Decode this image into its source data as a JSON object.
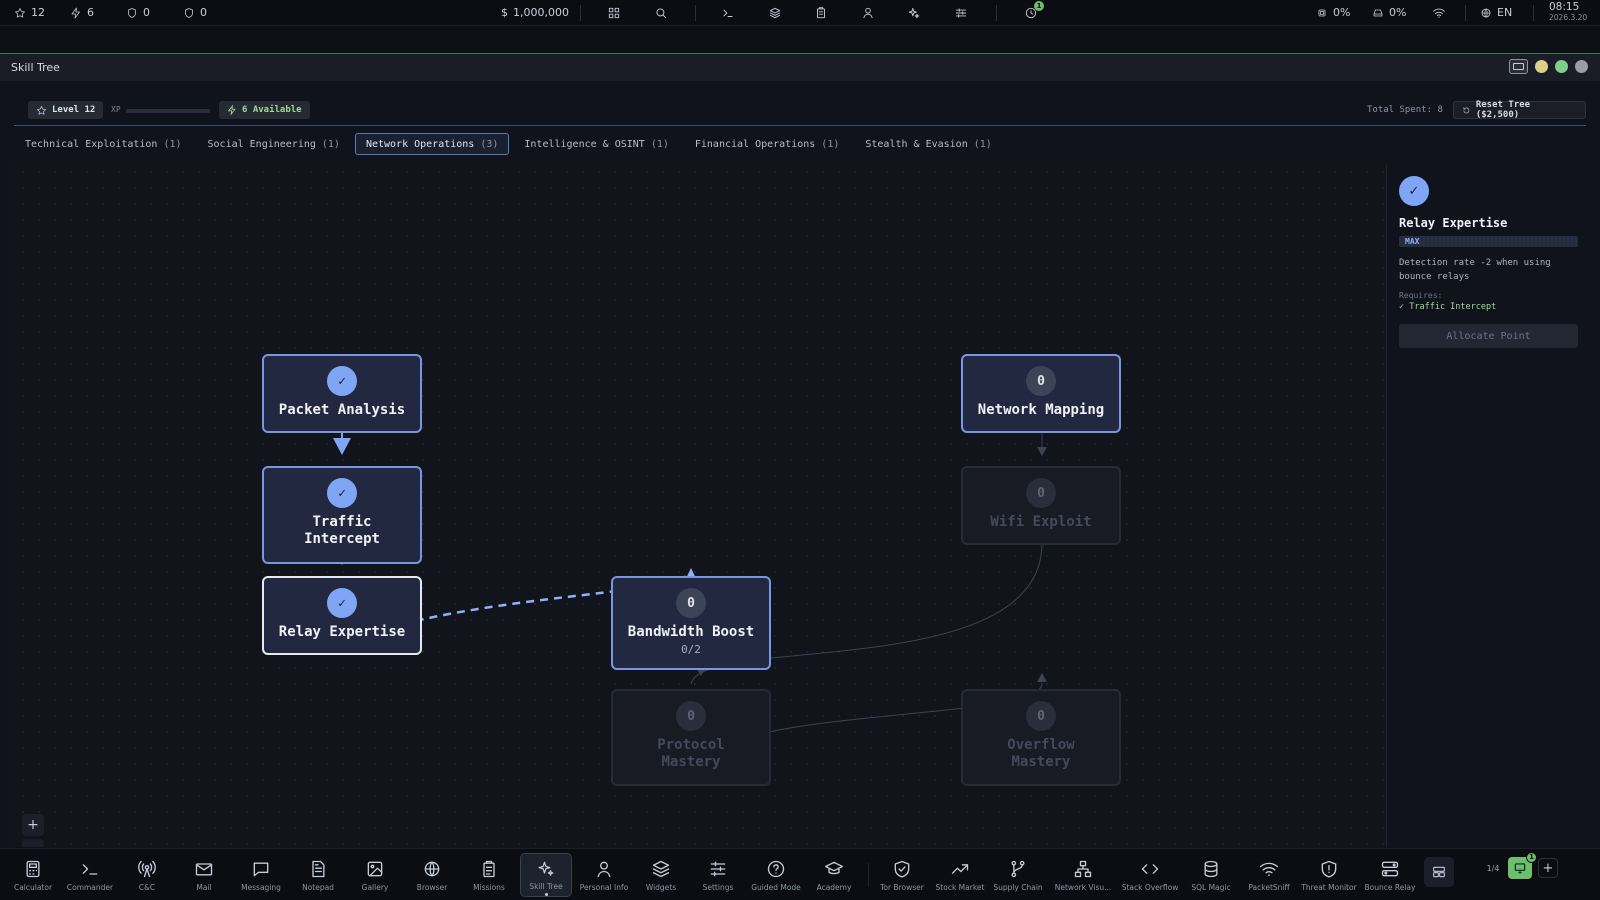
{
  "topbar": {
    "stars": "12",
    "bolts": "6",
    "shield_a": "0",
    "shield_b": "0",
    "money": "1,000,000",
    "notif_count": "1",
    "cpu": "0%",
    "disk": "0%",
    "lang": "EN",
    "time": "08:15",
    "date": "2026.3.20"
  },
  "window": {
    "title": "Skill Tree",
    "level_label": "Level 12",
    "xp_label": "XP",
    "xp_progress": 0,
    "available_label": "6 Available",
    "total_spent_label": "Total Spent: 8",
    "reset_label": "Reset Tree ($2,500)"
  },
  "tabs": [
    {
      "label": "Technical Exploitation",
      "count": "(1)"
    },
    {
      "label": "Social Engineering",
      "count": "(1)"
    },
    {
      "label": "Network Operations",
      "count": "(3)"
    },
    {
      "label": "Intelligence & OSINT",
      "count": "(1)"
    },
    {
      "label": "Financial Operations",
      "count": "(1)"
    },
    {
      "label": "Stealth & Evasion",
      "count": "(1)"
    }
  ],
  "nodes": {
    "packet_analysis": {
      "name": "Packet Analysis",
      "mark": "✓",
      "state": "unlocked"
    },
    "traffic_intercept": {
      "name": "Traffic Intercept",
      "mark": "✓",
      "state": "unlocked"
    },
    "relay_expertise": {
      "name": "Relay Expertise",
      "mark": "✓",
      "state": "selected"
    },
    "bandwidth_boost": {
      "name": "Bandwidth Boost",
      "mark": "0",
      "points": "0/2",
      "state": "available"
    },
    "protocol_mastery": {
      "name": "Protocol Mastery",
      "mark": "0",
      "state": "locked"
    },
    "network_mapping": {
      "name": "Network Mapping",
      "mark": "0",
      "state": "available"
    },
    "wifi_exploit": {
      "name": "Wifi Exploit",
      "mark": "0",
      "state": "locked"
    },
    "overflow_mastery": {
      "name": "Overflow Mastery",
      "mark": "0",
      "state": "locked"
    }
  },
  "zoom": {
    "plus": "+",
    "minus": "−",
    "fit": "⤢"
  },
  "panel": {
    "mark": "✓",
    "title": "Relay Expertise",
    "badge": "MAX",
    "description": "Detection rate -2 when using bounce relays",
    "requires_label": "Requires:",
    "requirement": "✓ Traffic Intercept",
    "allocate_label": "Allocate Point"
  },
  "dock": {
    "items": [
      {
        "label": "Calculator",
        "icon": "calculator-icon"
      },
      {
        "label": "Commander",
        "icon": "terminal-icon"
      },
      {
        "label": "C&C",
        "icon": "antenna-icon"
      },
      {
        "label": "Mail",
        "icon": "mail-icon"
      },
      {
        "label": "Messaging",
        "icon": "chat-icon"
      },
      {
        "label": "Notepad",
        "icon": "notepad-icon"
      },
      {
        "label": "Gallery",
        "icon": "image-icon"
      },
      {
        "label": "Browser",
        "icon": "globe-icon"
      },
      {
        "label": "Missions",
        "icon": "clipboard-icon"
      },
      {
        "label": "Skill Tree",
        "icon": "sparkles-icon"
      },
      {
        "label": "Personal Info",
        "icon": "user-icon"
      },
      {
        "label": "Widgets",
        "icon": "layers-icon"
      },
      {
        "label": "Settings",
        "icon": "sliders-icon"
      },
      {
        "label": "Guided Mode",
        "icon": "help-icon"
      },
      {
        "label": "Academy",
        "icon": "graduation-cap-icon"
      },
      {
        "label": "Tor Browser",
        "icon": "shield-check-icon"
      },
      {
        "label": "Stock Market",
        "icon": "trend-up-icon"
      },
      {
        "label": "Supply Chain",
        "icon": "branch-icon"
      },
      {
        "label": "Network Visu...",
        "icon": "network-icon"
      },
      {
        "label": "Stack Overflow",
        "icon": "code-icon"
      },
      {
        "label": "SQL Magic",
        "icon": "database-icon"
      },
      {
        "label": "PacketSniff",
        "icon": "wifi-icon"
      },
      {
        "label": "Threat Monitor",
        "icon": "shield-alert-icon"
      },
      {
        "label": "Bounce Relay",
        "icon": "relay-icon"
      }
    ],
    "page": "1/4",
    "badge": "1",
    "add": "+"
  },
  "colors": {
    "accent": "#7fa5f5",
    "node_border": "#7897e0",
    "success": "#6dbf6a"
  }
}
